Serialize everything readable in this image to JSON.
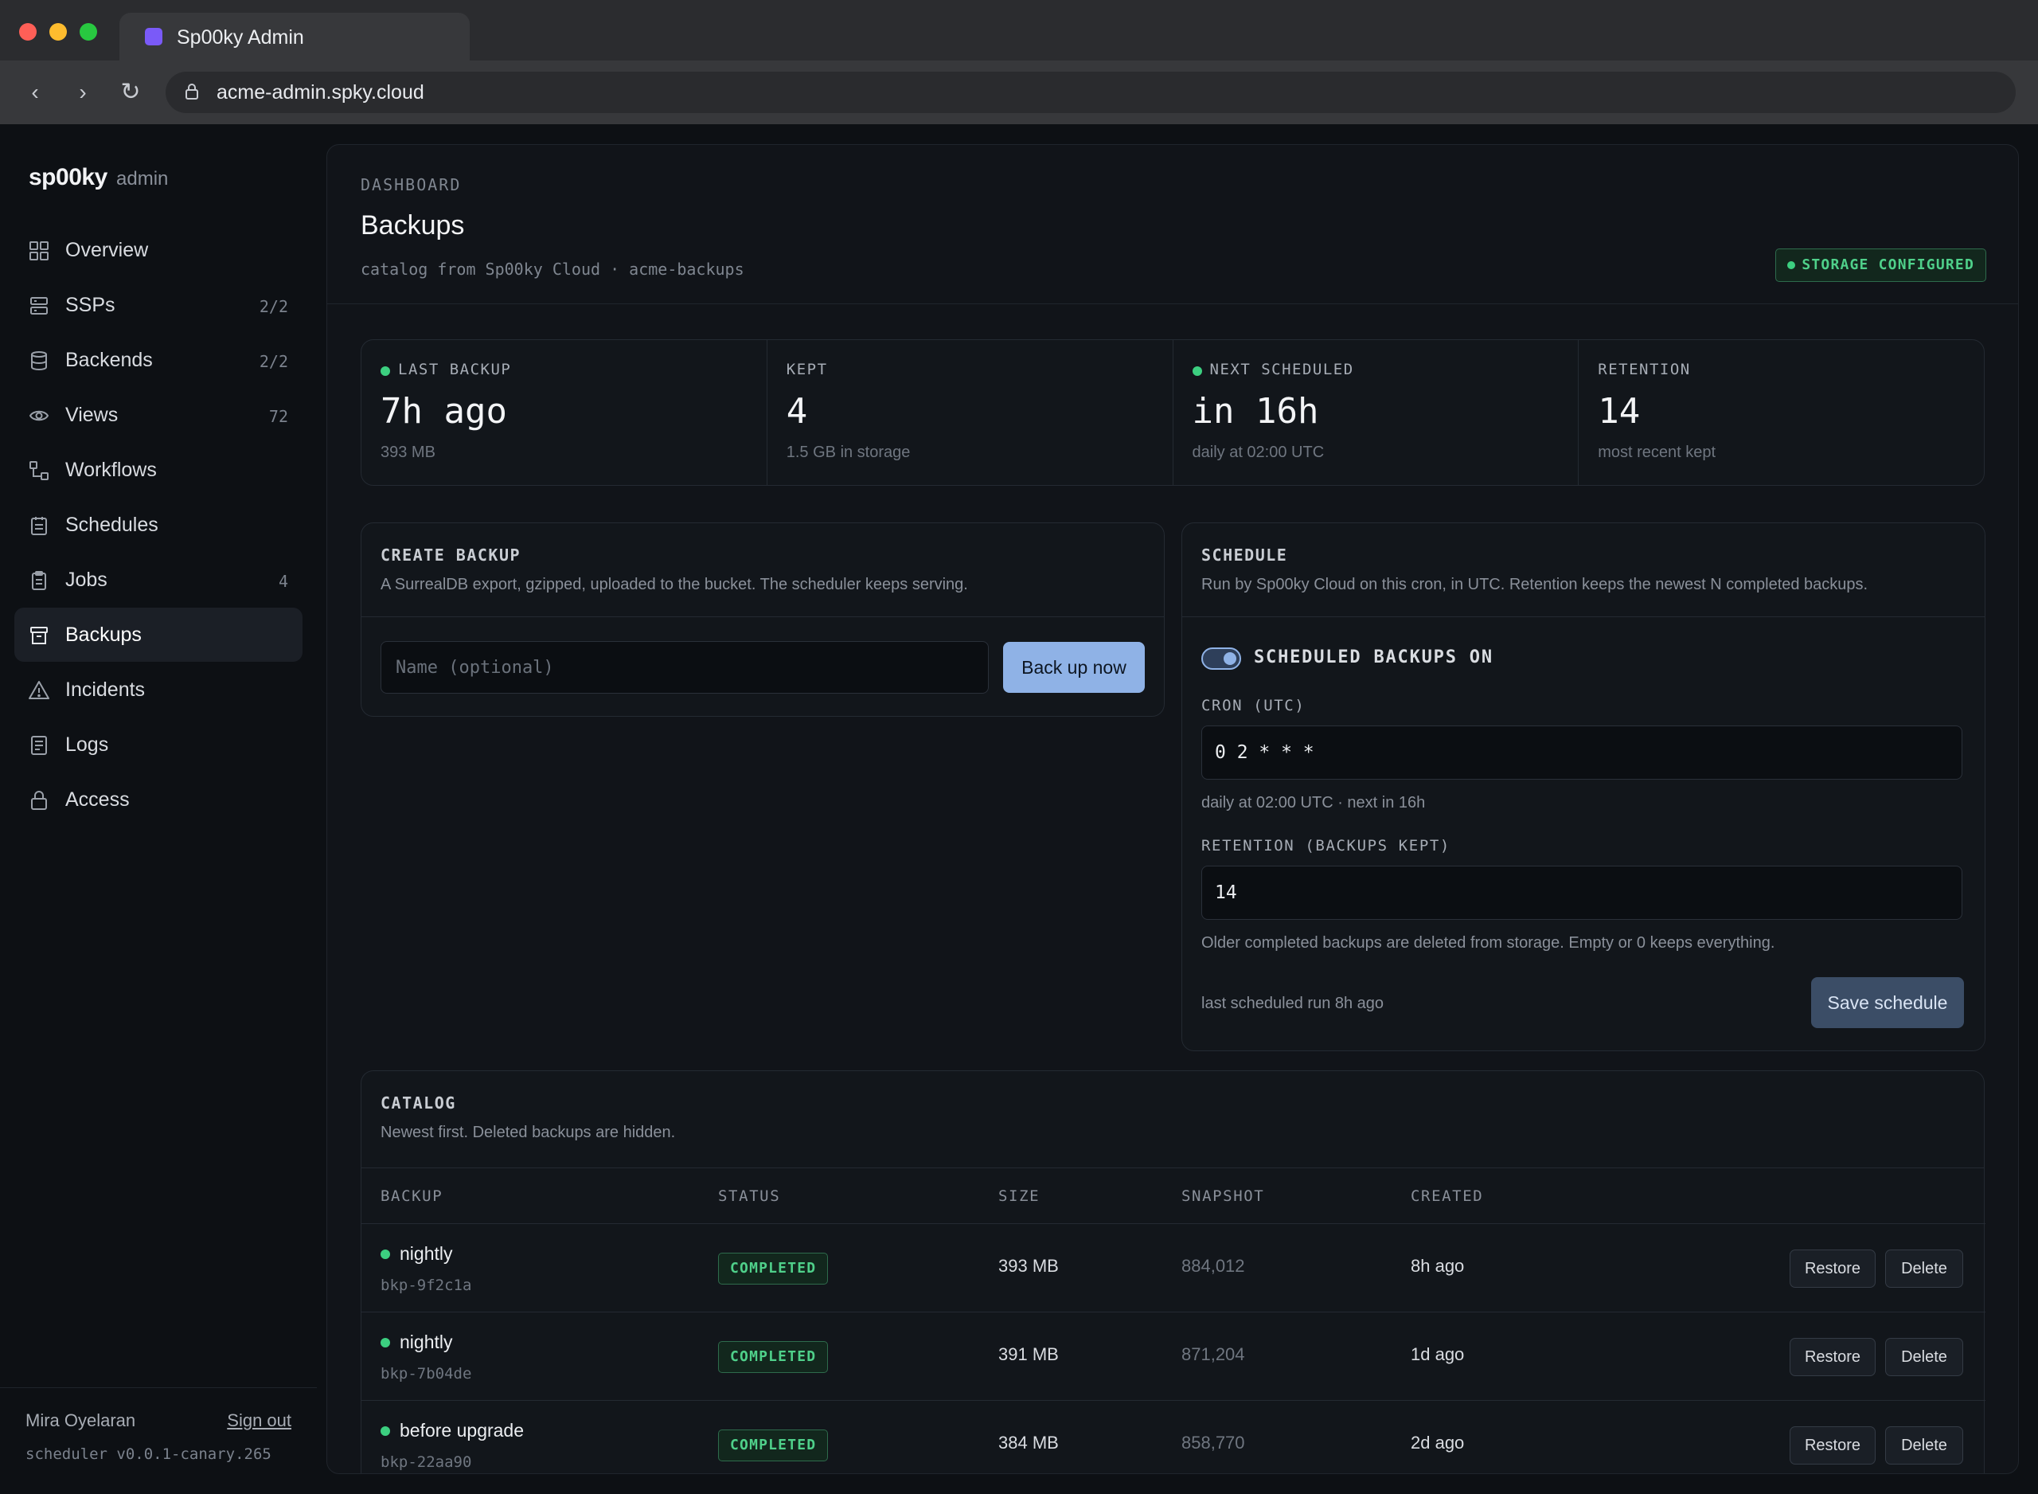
{
  "browser": {
    "tab_title": "Sp00ky Admin",
    "url": "acme-admin.spky.cloud"
  },
  "brand": {
    "name": "sp00ky",
    "sub": "admin"
  },
  "sidebar": {
    "items": [
      {
        "label": "Overview",
        "count": "",
        "icon": "grid-icon"
      },
      {
        "label": "SSPs",
        "count": "2/2",
        "icon": "server-icon"
      },
      {
        "label": "Backends",
        "count": "2/2",
        "icon": "database-icon"
      },
      {
        "label": "Views",
        "count": "72",
        "icon": "eye-icon"
      },
      {
        "label": "Workflows",
        "count": "",
        "icon": "workflow-icon"
      },
      {
        "label": "Schedules",
        "count": "",
        "icon": "calendar-icon"
      },
      {
        "label": "Jobs",
        "count": "4",
        "icon": "clipboard-icon"
      },
      {
        "label": "Backups",
        "count": "",
        "icon": "archive-icon",
        "active": true
      },
      {
        "label": "Incidents",
        "count": "",
        "icon": "warning-icon"
      },
      {
        "label": "Logs",
        "count": "",
        "icon": "document-icon"
      },
      {
        "label": "Access",
        "count": "",
        "icon": "lock-icon"
      }
    ],
    "user": "Mira Oyelaran",
    "sign_out": "Sign out",
    "version": "scheduler v0.0.1-canary.265"
  },
  "header": {
    "eyebrow": "DASHBOARD",
    "title": "Backups",
    "subtitle": "catalog from Sp00ky Cloud · acme-backups",
    "badge": "STORAGE CONFIGURED"
  },
  "stats": [
    {
      "label": "LAST BACKUP",
      "value": "7h ago",
      "sub": "393 MB",
      "dot": true
    },
    {
      "label": "KEPT",
      "value": "4",
      "sub": "1.5 GB in storage",
      "dot": false
    },
    {
      "label": "NEXT SCHEDULED",
      "value": "in 16h",
      "sub": "daily at 02:00 UTC",
      "dot": true
    },
    {
      "label": "RETENTION",
      "value": "14",
      "sub": "most recent kept",
      "dot": false
    }
  ],
  "create": {
    "title": "CREATE BACKUP",
    "desc": "A SurrealDB export, gzipped, uploaded to the bucket. The scheduler keeps serving.",
    "placeholder": "Name (optional)",
    "button": "Back up now"
  },
  "schedule": {
    "title": "SCHEDULE",
    "desc": "Run by Sp00ky Cloud on this cron, in UTC. Retention keeps the newest N completed backups.",
    "toggle_label": "SCHEDULED BACKUPS ON",
    "cron_label": "CRON (UTC)",
    "cron_value": "0 2 * * *",
    "cron_help": "daily at 02:00 UTC · next in 16h",
    "retention_label": "RETENTION (BACKUPS KEPT)",
    "retention_value": "14",
    "retention_help": "Older completed backups are deleted from storage. Empty or 0 keeps everything.",
    "last_run": "last scheduled run 8h ago",
    "save": "Save schedule"
  },
  "catalog": {
    "title": "CATALOG",
    "desc": "Newest first. Deleted backups are hidden.",
    "columns": [
      "BACKUP",
      "STATUS",
      "SIZE",
      "SNAPSHOT",
      "CREATED"
    ],
    "restore_label": "Restore",
    "delete_label": "Delete",
    "rows": [
      {
        "name": "nightly",
        "id": "bkp-9f2c1a",
        "status": "COMPLETED",
        "size": "393 MB",
        "snapshot": "884,012",
        "created": "8h ago"
      },
      {
        "name": "nightly",
        "id": "bkp-7b04de",
        "status": "COMPLETED",
        "size": "391 MB",
        "snapshot": "871,204",
        "created": "1d ago"
      },
      {
        "name": "before upgrade",
        "id": "bkp-22aa90",
        "status": "COMPLETED",
        "size": "384 MB",
        "snapshot": "858,770",
        "created": "2d ago"
      }
    ]
  }
}
